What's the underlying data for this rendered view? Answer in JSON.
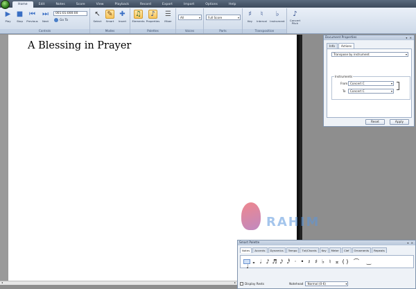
{
  "menu": [
    "Home",
    "Edit",
    "Notes",
    "Score",
    "View",
    "Playback",
    "Record",
    "Export",
    "Import",
    "Options",
    "Help"
  ],
  "ribbon": {
    "controls": {
      "label": "Controls",
      "play": "Play",
      "stop": "Stop",
      "previous": "Previous",
      "next": "Next",
      "time": "001:01:000:00",
      "goto": "Go To"
    },
    "modes": {
      "label": "Modes",
      "select": "Select",
      "smart": "Smart",
      "insert": "Insert"
    },
    "palettes": {
      "label": "Palettes",
      "elements": "Elements",
      "properties": "Properties",
      "mixer": "Mixer"
    },
    "voices": {
      "label": "Voices",
      "value": "All"
    },
    "parts": {
      "label": "Parts",
      "value": "Full Score"
    },
    "transposition": {
      "label": "Transposition",
      "key": "Key",
      "interval": "Interval",
      "instrument": "Instrument",
      "concert": "Concert Pitch"
    }
  },
  "score": {
    "title": "A Blessing in Prayer"
  },
  "doc_props": {
    "title": "Document Properties",
    "tabs": [
      "Info",
      "Actions"
    ],
    "transpose_by": "Transpose by instrument",
    "instruments_label": "Instruments",
    "from_label": "From",
    "from_value": "Concert C",
    "to_label": "To",
    "to_value": "Concert C",
    "reset": "Reset",
    "apply": "Apply"
  },
  "watermark": "RAHIM",
  "palette": {
    "title": "Smart Palette",
    "tabs": [
      "Notes",
      "Accents",
      "Dynamics",
      "Tempo",
      "Txt/Chords",
      "Key",
      "Meter",
      "Clef",
      "Ornaments",
      "Repeats"
    ],
    "symbols": [
      "𝅜",
      "𝅝",
      "𝅗𝅥",
      "♩",
      "♪",
      "♬",
      "𝅘𝅥𝅯",
      "𝅘𝅥𝅰",
      "·",
      "•",
      "𝄽",
      "♯",
      "♭",
      "♮",
      "𝄪",
      "( )",
      "⌒",
      "‿"
    ],
    "display_rests": "Display Rests",
    "notehead_label": "Notehead",
    "notehead_value": "Normal (0-6)"
  }
}
